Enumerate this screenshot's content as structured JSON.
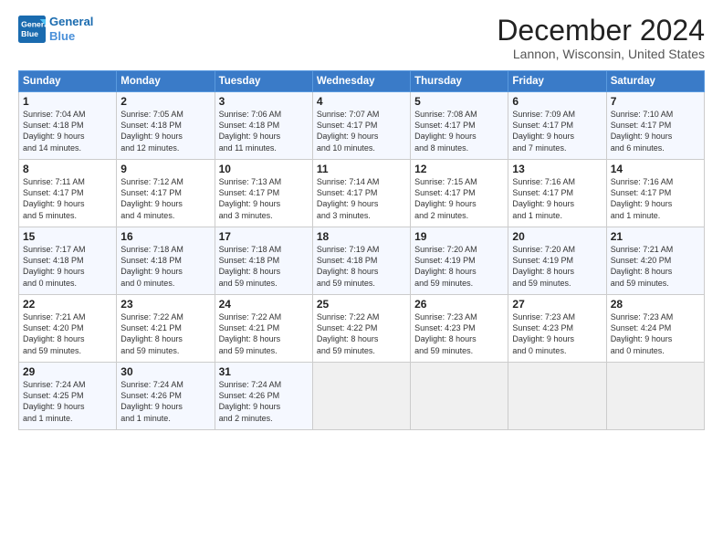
{
  "header": {
    "logo_line1": "General",
    "logo_line2": "Blue",
    "title": "December 2024",
    "subtitle": "Lannon, Wisconsin, United States"
  },
  "days_of_week": [
    "Sunday",
    "Monday",
    "Tuesday",
    "Wednesday",
    "Thursday",
    "Friday",
    "Saturday"
  ],
  "weeks": [
    [
      {
        "day": 1,
        "lines": [
          "Sunrise: 7:04 AM",
          "Sunset: 4:18 PM",
          "Daylight: 9 hours",
          "and 14 minutes."
        ]
      },
      {
        "day": 2,
        "lines": [
          "Sunrise: 7:05 AM",
          "Sunset: 4:18 PM",
          "Daylight: 9 hours",
          "and 12 minutes."
        ]
      },
      {
        "day": 3,
        "lines": [
          "Sunrise: 7:06 AM",
          "Sunset: 4:18 PM",
          "Daylight: 9 hours",
          "and 11 minutes."
        ]
      },
      {
        "day": 4,
        "lines": [
          "Sunrise: 7:07 AM",
          "Sunset: 4:17 PM",
          "Daylight: 9 hours",
          "and 10 minutes."
        ]
      },
      {
        "day": 5,
        "lines": [
          "Sunrise: 7:08 AM",
          "Sunset: 4:17 PM",
          "Daylight: 9 hours",
          "and 8 minutes."
        ]
      },
      {
        "day": 6,
        "lines": [
          "Sunrise: 7:09 AM",
          "Sunset: 4:17 PM",
          "Daylight: 9 hours",
          "and 7 minutes."
        ]
      },
      {
        "day": 7,
        "lines": [
          "Sunrise: 7:10 AM",
          "Sunset: 4:17 PM",
          "Daylight: 9 hours",
          "and 6 minutes."
        ]
      }
    ],
    [
      {
        "day": 8,
        "lines": [
          "Sunrise: 7:11 AM",
          "Sunset: 4:17 PM",
          "Daylight: 9 hours",
          "and 5 minutes."
        ]
      },
      {
        "day": 9,
        "lines": [
          "Sunrise: 7:12 AM",
          "Sunset: 4:17 PM",
          "Daylight: 9 hours",
          "and 4 minutes."
        ]
      },
      {
        "day": 10,
        "lines": [
          "Sunrise: 7:13 AM",
          "Sunset: 4:17 PM",
          "Daylight: 9 hours",
          "and 3 minutes."
        ]
      },
      {
        "day": 11,
        "lines": [
          "Sunrise: 7:14 AM",
          "Sunset: 4:17 PM",
          "Daylight: 9 hours",
          "and 3 minutes."
        ]
      },
      {
        "day": 12,
        "lines": [
          "Sunrise: 7:15 AM",
          "Sunset: 4:17 PM",
          "Daylight: 9 hours",
          "and 2 minutes."
        ]
      },
      {
        "day": 13,
        "lines": [
          "Sunrise: 7:16 AM",
          "Sunset: 4:17 PM",
          "Daylight: 9 hours",
          "and 1 minute."
        ]
      },
      {
        "day": 14,
        "lines": [
          "Sunrise: 7:16 AM",
          "Sunset: 4:17 PM",
          "Daylight: 9 hours",
          "and 1 minute."
        ]
      }
    ],
    [
      {
        "day": 15,
        "lines": [
          "Sunrise: 7:17 AM",
          "Sunset: 4:18 PM",
          "Daylight: 9 hours",
          "and 0 minutes."
        ]
      },
      {
        "day": 16,
        "lines": [
          "Sunrise: 7:18 AM",
          "Sunset: 4:18 PM",
          "Daylight: 9 hours",
          "and 0 minutes."
        ]
      },
      {
        "day": 17,
        "lines": [
          "Sunrise: 7:18 AM",
          "Sunset: 4:18 PM",
          "Daylight: 8 hours",
          "and 59 minutes."
        ]
      },
      {
        "day": 18,
        "lines": [
          "Sunrise: 7:19 AM",
          "Sunset: 4:18 PM",
          "Daylight: 8 hours",
          "and 59 minutes."
        ]
      },
      {
        "day": 19,
        "lines": [
          "Sunrise: 7:20 AM",
          "Sunset: 4:19 PM",
          "Daylight: 8 hours",
          "and 59 minutes."
        ]
      },
      {
        "day": 20,
        "lines": [
          "Sunrise: 7:20 AM",
          "Sunset: 4:19 PM",
          "Daylight: 8 hours",
          "and 59 minutes."
        ]
      },
      {
        "day": 21,
        "lines": [
          "Sunrise: 7:21 AM",
          "Sunset: 4:20 PM",
          "Daylight: 8 hours",
          "and 59 minutes."
        ]
      }
    ],
    [
      {
        "day": 22,
        "lines": [
          "Sunrise: 7:21 AM",
          "Sunset: 4:20 PM",
          "Daylight: 8 hours",
          "and 59 minutes."
        ]
      },
      {
        "day": 23,
        "lines": [
          "Sunrise: 7:22 AM",
          "Sunset: 4:21 PM",
          "Daylight: 8 hours",
          "and 59 minutes."
        ]
      },
      {
        "day": 24,
        "lines": [
          "Sunrise: 7:22 AM",
          "Sunset: 4:21 PM",
          "Daylight: 8 hours",
          "and 59 minutes."
        ]
      },
      {
        "day": 25,
        "lines": [
          "Sunrise: 7:22 AM",
          "Sunset: 4:22 PM",
          "Daylight: 8 hours",
          "and 59 minutes."
        ]
      },
      {
        "day": 26,
        "lines": [
          "Sunrise: 7:23 AM",
          "Sunset: 4:23 PM",
          "Daylight: 8 hours",
          "and 59 minutes."
        ]
      },
      {
        "day": 27,
        "lines": [
          "Sunrise: 7:23 AM",
          "Sunset: 4:23 PM",
          "Daylight: 9 hours",
          "and 0 minutes."
        ]
      },
      {
        "day": 28,
        "lines": [
          "Sunrise: 7:23 AM",
          "Sunset: 4:24 PM",
          "Daylight: 9 hours",
          "and 0 minutes."
        ]
      }
    ],
    [
      {
        "day": 29,
        "lines": [
          "Sunrise: 7:24 AM",
          "Sunset: 4:25 PM",
          "Daylight: 9 hours",
          "and 1 minute."
        ]
      },
      {
        "day": 30,
        "lines": [
          "Sunrise: 7:24 AM",
          "Sunset: 4:26 PM",
          "Daylight: 9 hours",
          "and 1 minute."
        ]
      },
      {
        "day": 31,
        "lines": [
          "Sunrise: 7:24 AM",
          "Sunset: 4:26 PM",
          "Daylight: 9 hours",
          "and 2 minutes."
        ]
      },
      null,
      null,
      null,
      null
    ]
  ]
}
